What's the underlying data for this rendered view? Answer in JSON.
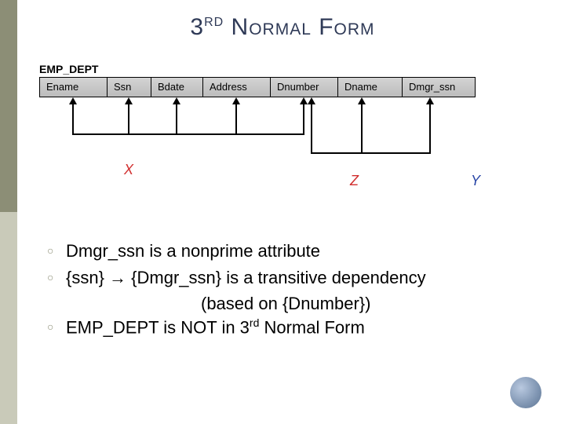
{
  "title": {
    "pre": "3",
    "sup": "RD",
    "post": " Normal Form"
  },
  "table": {
    "name": "EMP_DEPT",
    "cols": [
      "Ename",
      "Ssn",
      "Bdate",
      "Address",
      "Dnumber",
      "Dname",
      "Dmgr_ssn"
    ]
  },
  "labels": {
    "x": "X",
    "z": "Z",
    "y": "Y"
  },
  "bullets": {
    "b1": "Dmgr_ssn is a nonprime attribute",
    "b2": "{ssn} → {Dmgr_ssn} is a transitive dependency",
    "b2sub": "(based on {Dnumber})",
    "b3_a": "EMP_DEPT is NOT in 3",
    "b3_sup": "rd",
    "b3_b": " Normal Form"
  }
}
